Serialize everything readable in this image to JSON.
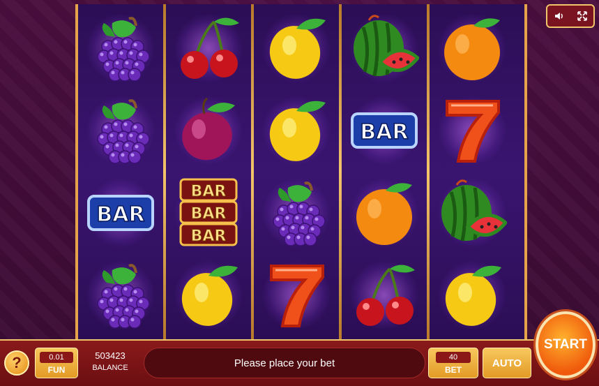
{
  "controls": {
    "sound_icon": "speaker-icon",
    "fullscreen_icon": "fullscreen-icon"
  },
  "reels": [
    [
      "grapes",
      "grapes",
      "bar",
      "grapes"
    ],
    [
      "cherries",
      "plum",
      "bar-triple",
      "lemon"
    ],
    [
      "lemon",
      "lemon",
      "grapes",
      "seven"
    ],
    [
      "watermelon",
      "bar",
      "orange",
      "cherries"
    ],
    [
      "orange",
      "seven",
      "watermelon",
      "lemon"
    ]
  ],
  "symbols": {
    "bar_text": "BAR"
  },
  "bottom_bar": {
    "help_label": "?",
    "fun_value": "0.01",
    "fun_label": "FUN",
    "balance_value": "503423",
    "balance_label": "BALANCE",
    "message": "Please place your bet",
    "bet_value": "40",
    "bet_label": "BET",
    "auto_label": "AUTO",
    "start_label": "START"
  },
  "colors": {
    "frame_gold": "#e7a34a",
    "panel_red": "#8a1a1a",
    "start_orange": "#f05a0c"
  }
}
